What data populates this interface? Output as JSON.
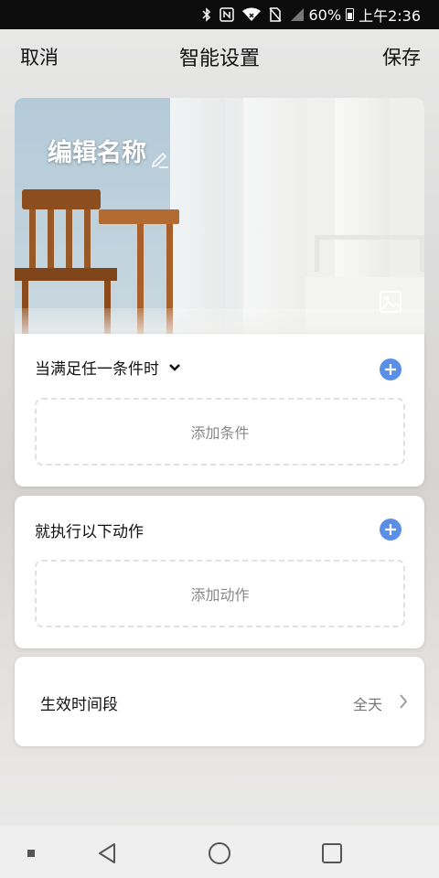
{
  "status_bar": {
    "battery": "60%",
    "time": "上午2:36",
    "icons": [
      "bluetooth-icon",
      "nfc-icon",
      "wifi-icon",
      "no-sim-icon",
      "signal-icon",
      "battery-icon"
    ]
  },
  "header": {
    "cancel_label": "取消",
    "title": "智能设置",
    "save_label": "保存"
  },
  "hero": {
    "name_label": "编辑名称",
    "icons": [
      "pencil-icon",
      "image-icon"
    ]
  },
  "condition_card": {
    "title": "当满足任一条件时",
    "add_label": "添加条件",
    "icons": [
      "chevron-down-icon",
      "plus-icon"
    ]
  },
  "action_card": {
    "title": "就执行以下动作",
    "add_label": "添加动作",
    "icons": [
      "plus-icon"
    ]
  },
  "time_card": {
    "label": "生效时间段",
    "value": "全天",
    "icons": [
      "chevron-right-icon"
    ]
  },
  "colors": {
    "accent": "#5b8fe6",
    "text": "#111111",
    "secondary_text": "#888888",
    "status_bar": "#0c0c0c"
  }
}
